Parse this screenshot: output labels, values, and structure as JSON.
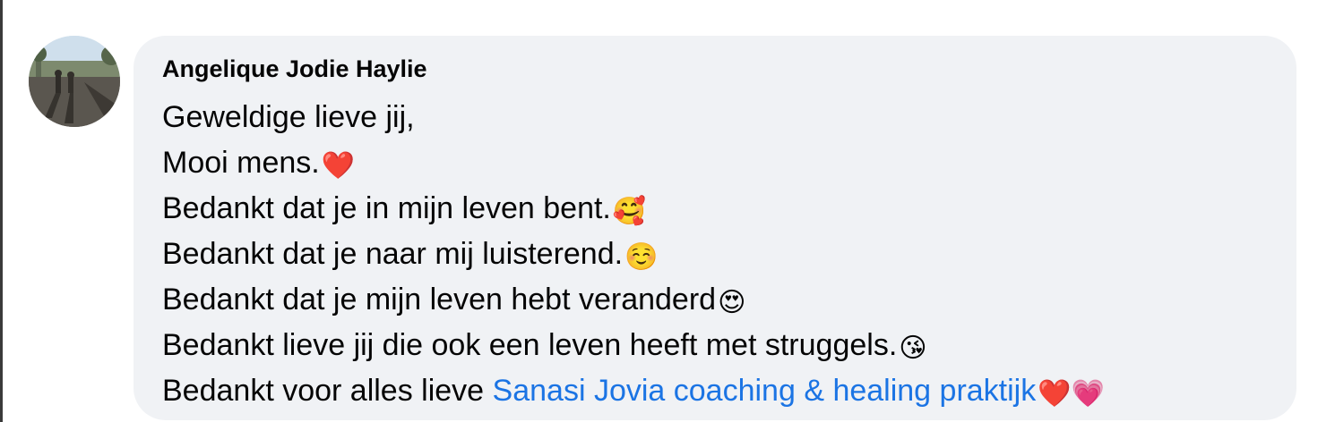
{
  "comment": {
    "author": "Angelique Jodie Haylie",
    "lines": [
      {
        "text": "Geweldige lieve jij,",
        "emoji": ""
      },
      {
        "text": "Mooi mens.",
        "emoji": "❤️"
      },
      {
        "text": "Bedankt dat je in mijn leven bent.",
        "emoji": "🥰"
      },
      {
        "text": "Bedankt dat je naar mij luisterend.",
        "emoji": "☺️"
      },
      {
        "text": "Bedankt dat je mijn leven hebt veranderd",
        "emoji": "😍"
      },
      {
        "text": "Bedankt lieve jij die ook een leven heeft met struggels.",
        "emoji": "😘"
      }
    ],
    "last_line": {
      "text": "Bedankt voor alles lieve ",
      "mention": "Sanasi Jovia coaching & healing praktijk",
      "emoji": " ❤️💗"
    }
  },
  "colors": {
    "bubble_bg": "#f0f2f5",
    "text": "#050505",
    "mention": "#1b74e4"
  }
}
